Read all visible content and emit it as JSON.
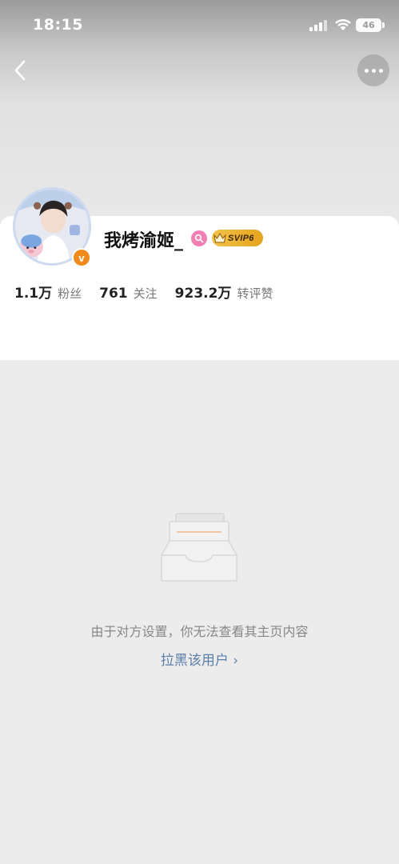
{
  "status_bar": {
    "time": "18:15",
    "battery": "46",
    "icons": [
      "signal-icon",
      "wifi-icon",
      "battery-icon"
    ]
  },
  "nav": {
    "back_icon": "back-chevron-icon",
    "more_icon": "more-dots-icon"
  },
  "profile": {
    "username": "我烤渝姬_",
    "verified_icon": "v",
    "badges": {
      "search_icon": "lens-icon",
      "svip_label": "SVIP6"
    },
    "stats": [
      {
        "value": "1.1万",
        "label": "粉丝"
      },
      {
        "value": "761",
        "label": "关注"
      },
      {
        "value": "923.2万",
        "label": "转评赞"
      }
    ]
  },
  "empty_state": {
    "icon": "empty-inbox-icon",
    "message": "由于对方设置，你无法查看其主页内容",
    "block_link": "拉黑该用户 ›"
  },
  "colors": {
    "background": "#ececec",
    "accent_link": "#5b7ea8",
    "verified": "#f08a1c",
    "svip_gold": "#e4a41d",
    "lens_pink": "#f27fb3"
  }
}
